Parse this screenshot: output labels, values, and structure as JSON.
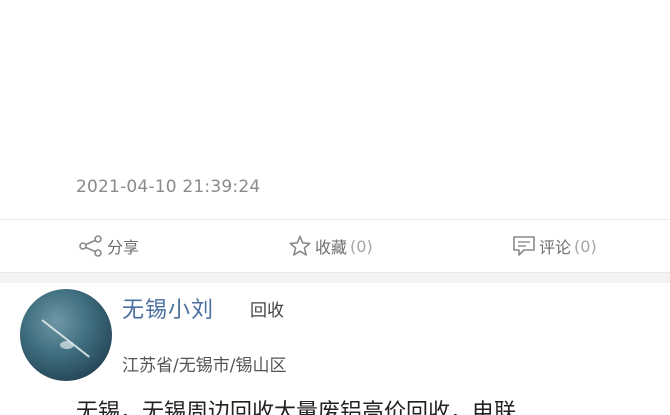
{
  "post": {
    "timestamp": "2021-04-10 21:39:24"
  },
  "actions": {
    "share_label": "分享",
    "favorite_label": "收藏",
    "favorite_count": "(0)",
    "comment_label": "评论",
    "comment_count": "(0)"
  },
  "next_post": {
    "username": "无锡小刘",
    "tag": "回收",
    "location": "江苏省/无锡市/锡山区",
    "text": "无锡，无锡周边回收大量废铝高价回收，电联"
  },
  "colors": {
    "username": "#4a6ea0",
    "muted": "#8a8a8a"
  },
  "icons": {
    "share": "share-icon",
    "favorite": "star-icon",
    "comment": "comment-icon"
  }
}
